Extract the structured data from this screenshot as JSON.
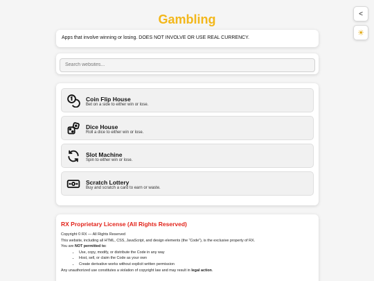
{
  "header": {
    "title": "Gambling"
  },
  "controls": {
    "back_label": "<",
    "theme_label": "☀"
  },
  "description": "Apps that involve winning or losing. DOES NOT INVOLVE OR USE REAL CURRENCY.",
  "search": {
    "placeholder": "Search websites..."
  },
  "apps": [
    {
      "name": "Coin Flip House",
      "desc": "Bet on a side to either win or lose.",
      "icon": "coins-icon"
    },
    {
      "name": "Dice House",
      "desc": "Roll a dice to either win or lose.",
      "icon": "dice-icon"
    },
    {
      "name": "Slot Machine",
      "desc": "Spin to either win or lose.",
      "icon": "refresh-icon"
    },
    {
      "name": "Scratch Lottery",
      "desc": "Buy and scratch a card to earn or waste.",
      "icon": "cash-icon"
    }
  ],
  "license": {
    "title": "RX Proprietary License (All Rights Reserved)",
    "copyright": "Copyright © RX — All Rights Reserved",
    "ownership": "This website, including all HTML, CSS, JavaScript, and design elements (the “Code”), is the exclusive property of RX.",
    "not_permitted_prefix": "You are ",
    "not_permitted_bold": "NOT permitted to:",
    "restrictions": [
      "Use, copy, modify, or distribute the Code in any way",
      "Host, sell, or claim the Code as your own",
      "Create derivative works without explicit written permission"
    ],
    "violation_prefix": "Any unauthorized use constitutes a violation of copyright law and may result in ",
    "violation_bold": "legal action",
    "violation_suffix": "."
  },
  "colors": {
    "title": "#f3b71a",
    "license_title": "#e2231a",
    "background": "#f5f5f5"
  }
}
